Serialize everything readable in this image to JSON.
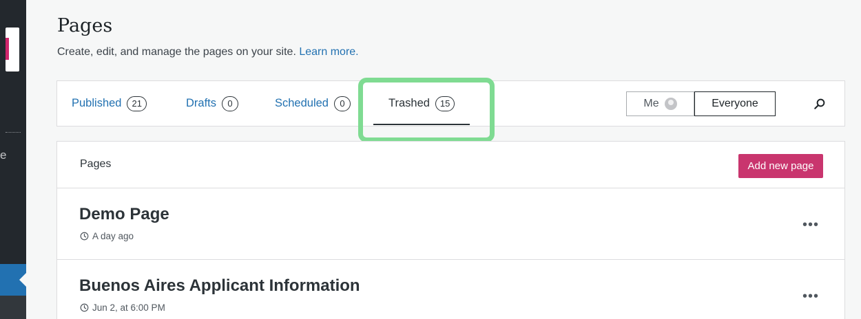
{
  "header": {
    "title": "Pages",
    "subtitle": "Create, edit, and manage the pages on your site.",
    "learn_more": "Learn more."
  },
  "sidebar": {
    "fragment": "e"
  },
  "tabs": [
    {
      "label": "Published",
      "count": "21"
    },
    {
      "label": "Drafts",
      "count": "0"
    },
    {
      "label": "Scheduled",
      "count": "0"
    },
    {
      "label": "Trashed",
      "count": "15",
      "active": true
    }
  ],
  "filter": {
    "me": "Me",
    "everyone": "Everyone",
    "selected": "Everyone"
  },
  "panel": {
    "title": "Pages",
    "add_button": "Add new page",
    "rows": [
      {
        "title": "Demo Page",
        "time": "A day ago"
      },
      {
        "title": "Buenos Aires Applicant Information",
        "time": "Jun 2, at 6:00 PM"
      }
    ],
    "more_label": "•••"
  },
  "colors": {
    "accent": "#2271b1",
    "brand": "#c9356e",
    "highlight": "#7fdb92",
    "sidebar": "#23282d"
  },
  "icons": {
    "search": "search-icon",
    "clock": "clock-icon",
    "avatar": "avatar-icon",
    "more": "ellipsis-icon"
  }
}
